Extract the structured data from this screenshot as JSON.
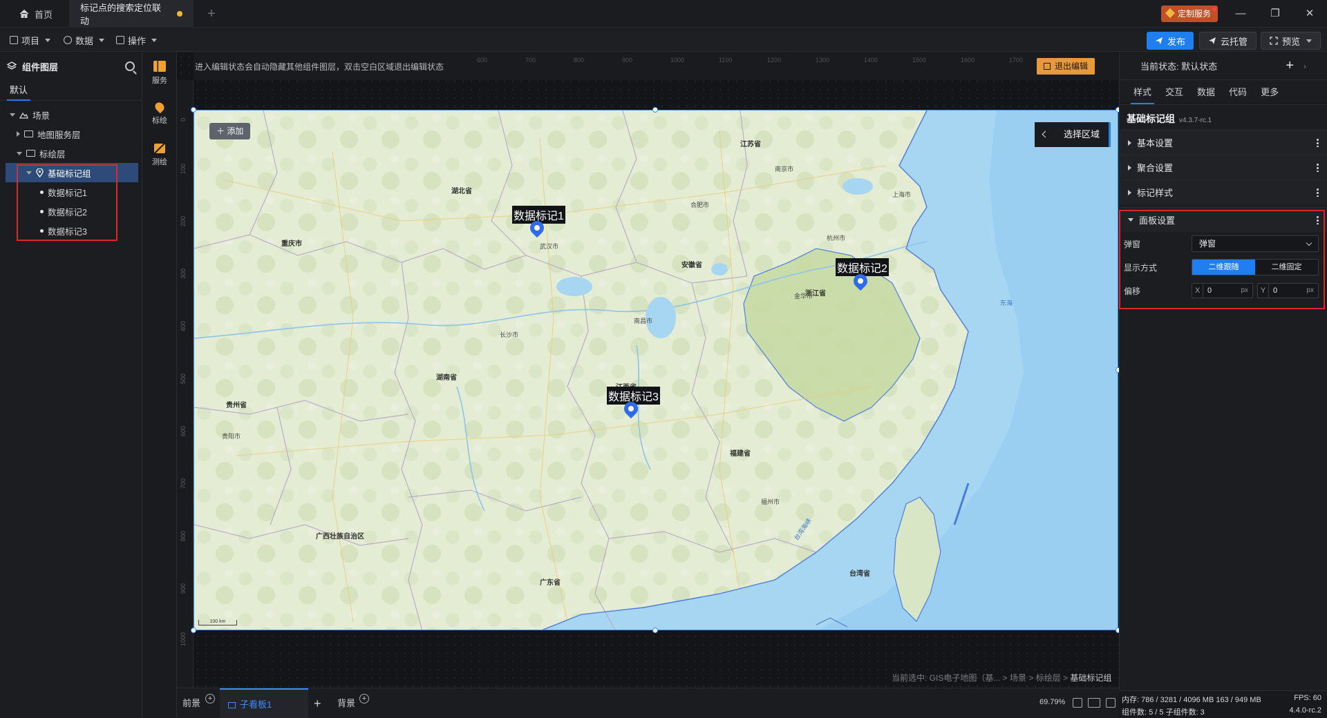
{
  "window": {
    "home_tab": "首页",
    "active_tab": "标记点的搜索定位联动",
    "service_button": "定制服务"
  },
  "toolbar": {
    "menu_project": "项目",
    "menu_data": "数据",
    "menu_operate": "操作",
    "publish": "发布",
    "cloud_host": "云托管",
    "preview": "预览"
  },
  "left_panel": {
    "title": "组件图层",
    "tab": "默认",
    "tree": [
      {
        "label": "场景",
        "level": 0,
        "type": "scene"
      },
      {
        "label": "地图服务层",
        "level": 1,
        "type": "folder"
      },
      {
        "label": "标绘层",
        "level": 1,
        "type": "folder"
      },
      {
        "label": "基础标记组",
        "level": 2,
        "type": "group",
        "selected": true
      },
      {
        "label": "数据标记1",
        "level": 3,
        "type": "item"
      },
      {
        "label": "数据标记2",
        "level": 3,
        "type": "item"
      },
      {
        "label": "数据标记3",
        "level": 3,
        "type": "item"
      }
    ]
  },
  "icon_column": {
    "service": "服务",
    "marker": "标绘",
    "measure": "测绘"
  },
  "canvas": {
    "edit_message": "进入编辑状态会自动隐藏其他组件图层，双击空白区域退出编辑状态",
    "exit_edit": "退出编辑",
    "ruler_left_ticks": [
      "0",
      "100",
      "200",
      "300",
      "400",
      "500",
      "600",
      "700",
      "800",
      "900",
      "1000"
    ],
    "ruler_top_ticks": [
      "600",
      "700",
      "800",
      "900",
      "1000",
      "1100",
      "1200",
      "1300",
      "1400",
      "1500",
      "1600",
      "1700",
      "1800"
    ],
    "map_add": "添加",
    "select_region": "选择区域",
    "markers": [
      {
        "label": "数据标记1"
      },
      {
        "label": "数据标记2"
      },
      {
        "label": "数据标记3"
      }
    ],
    "scale_text": "100 km",
    "places": {
      "hubei": "湖北省",
      "anhui": "安徽省",
      "jiangsu": "江苏省",
      "shanghai": "上海市",
      "zhejiang": "浙江省",
      "jiangxi": "江西省",
      "hunan": "湖南省",
      "fujian": "福建省",
      "guizhou": "贵州省",
      "guangxi": "广西壮族自治区",
      "guangdong": "广东省",
      "taiwan": "台湾省",
      "chongqing": "重庆市",
      "hangzhou": "杭州市",
      "nanjing": "南京市",
      "wuhan": "武汉市",
      "jinhua": "金华市",
      "hefei": "合肥市",
      "nanchang": "南昌市",
      "changsha": "长沙市",
      "fuzhou": "福州市",
      "guiyang": "贵阳市",
      "donghai": "东海",
      "strait": "台湾海峡"
    },
    "breadcrumb_prefix": "当前选中: GIS电子地图（基... > 场景 > 标绘层 > ",
    "breadcrumb_current": "基础标记组"
  },
  "bottom_bar": {
    "front": "前景",
    "sub_board": "子看板1",
    "back": "背景",
    "zoom": "69.79%"
  },
  "right_panel": {
    "state_label": "当前状态:  默认状态",
    "tabs": [
      "样式",
      "交互",
      "数据",
      "代码",
      "更多"
    ],
    "component_name": "基础标记组",
    "version": "v4.3.7-rc.1",
    "sections": {
      "basic": "基本设置",
      "cluster": "聚合设置",
      "marker_style": "标记样式",
      "panel": "面板设置"
    },
    "panel_settings": {
      "popup_label": "弹窗",
      "popup_value": "弹窗",
      "display_label": "显示方式",
      "display_options": [
        "二维跟随",
        "二维固定"
      ],
      "display_selected": "二维跟随",
      "offset_label": "偏移",
      "offset_x_prefix": "X",
      "offset_x": "0",
      "offset_y_prefix": "Y",
      "offset_y": "0",
      "unit": "px"
    }
  },
  "status": {
    "memory": "内存:  786 / 3281 / 4096 MB  163 / 949 MB",
    "fps": "FPS:  60",
    "components": "组件数: 5 / 5   子组件数: 3",
    "version": "4.4.0-rc.2"
  },
  "colors": {
    "accent": "#1f7ff0",
    "annotation_box": "#e0252b",
    "exit_button": "#e69a3a",
    "service_button": "#c0502a"
  }
}
